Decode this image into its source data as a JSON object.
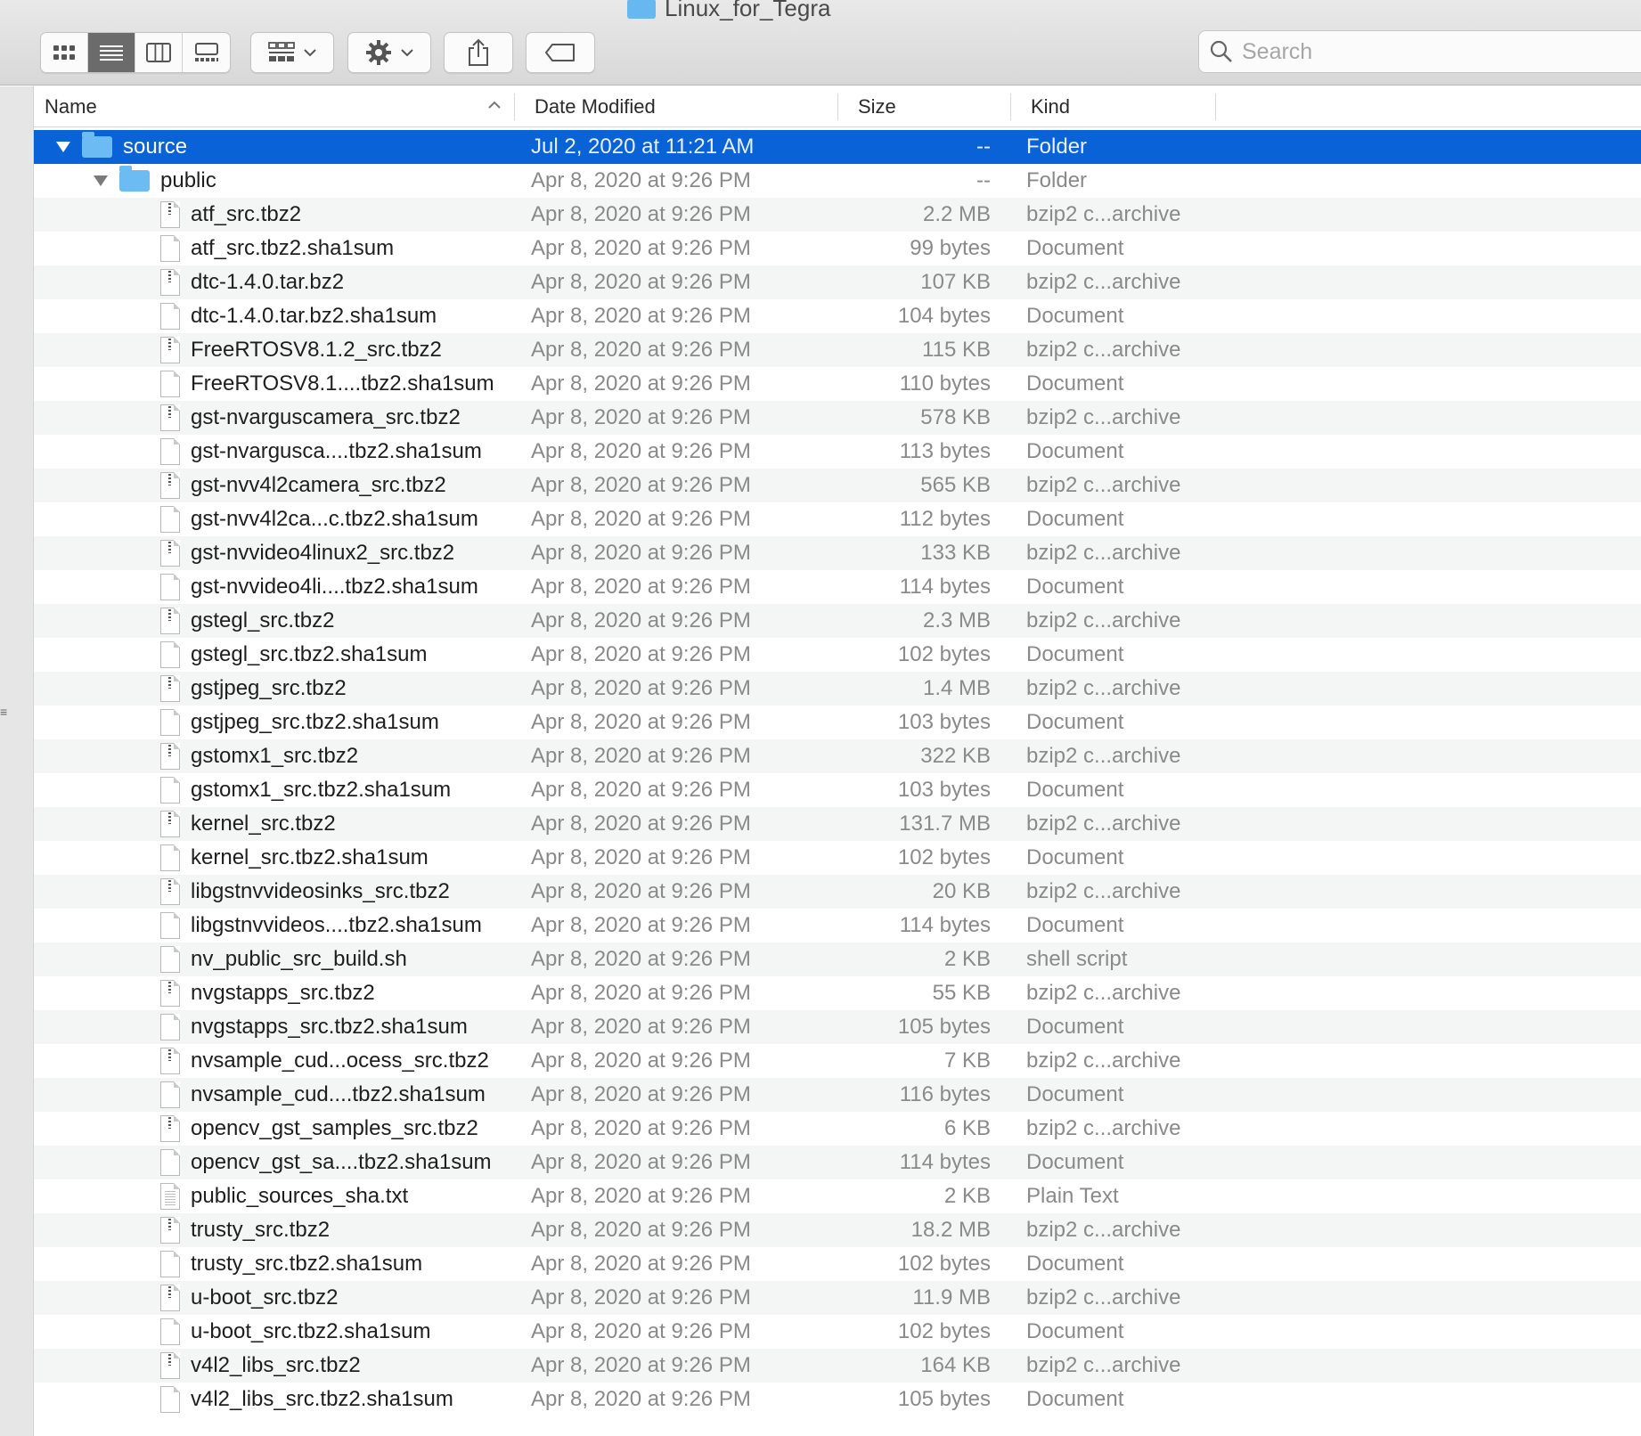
{
  "window": {
    "title": "Linux_for_Tegra"
  },
  "toolbar": {
    "view_modes": [
      "icon-view",
      "list-view",
      "column-view",
      "gallery-view"
    ],
    "active_view": "list-view",
    "group_icon": "group-by-icon",
    "action_icon": "gear-icon",
    "share_icon": "share-icon",
    "tag_icon": "tag-icon"
  },
  "search": {
    "placeholder": "Search"
  },
  "columns": {
    "name": "Name",
    "date": "Date Modified",
    "size": "Size",
    "kind": "Kind"
  },
  "colors": {
    "selection": "#0a63d6",
    "folder": "#6cbcf3"
  },
  "rows": [
    {
      "type": "folder",
      "level": 0,
      "expanded": true,
      "selected": true,
      "name": "source",
      "date": "Jul 2, 2020 at 11:21 AM",
      "size": "--",
      "kind": "Folder"
    },
    {
      "type": "folder",
      "level": 1,
      "expanded": true,
      "selected": false,
      "name": "public",
      "date": "Apr 8, 2020 at 9:26 PM",
      "size": "--",
      "kind": "Folder"
    },
    {
      "type": "zip",
      "level": 2,
      "name": "atf_src.tbz2",
      "date": "Apr 8, 2020 at 9:26 PM",
      "size": "2.2 MB",
      "kind": "bzip2 c...archive"
    },
    {
      "type": "doc",
      "level": 2,
      "name": "atf_src.tbz2.sha1sum",
      "date": "Apr 8, 2020 at 9:26 PM",
      "size": "99 bytes",
      "kind": "Document"
    },
    {
      "type": "zip",
      "level": 2,
      "name": "dtc-1.4.0.tar.bz2",
      "date": "Apr 8, 2020 at 9:26 PM",
      "size": "107 KB",
      "kind": "bzip2 c...archive"
    },
    {
      "type": "doc",
      "level": 2,
      "name": "dtc-1.4.0.tar.bz2.sha1sum",
      "date": "Apr 8, 2020 at 9:26 PM",
      "size": "104 bytes",
      "kind": "Document"
    },
    {
      "type": "zip",
      "level": 2,
      "name": "FreeRTOSV8.1.2_src.tbz2",
      "date": "Apr 8, 2020 at 9:26 PM",
      "size": "115 KB",
      "kind": "bzip2 c...archive"
    },
    {
      "type": "doc",
      "level": 2,
      "name": "FreeRTOSV8.1....tbz2.sha1sum",
      "date": "Apr 8, 2020 at 9:26 PM",
      "size": "110 bytes",
      "kind": "Document"
    },
    {
      "type": "zip",
      "level": 2,
      "name": "gst-nvarguscamera_src.tbz2",
      "date": "Apr 8, 2020 at 9:26 PM",
      "size": "578 KB",
      "kind": "bzip2 c...archive"
    },
    {
      "type": "doc",
      "level": 2,
      "name": "gst-nvarguscа....tbz2.sha1sum",
      "date": "Apr 8, 2020 at 9:26 PM",
      "size": "113 bytes",
      "kind": "Document"
    },
    {
      "type": "zip",
      "level": 2,
      "name": "gst-nvv4l2camera_src.tbz2",
      "date": "Apr 8, 2020 at 9:26 PM",
      "size": "565 KB",
      "kind": "bzip2 c...archive"
    },
    {
      "type": "doc",
      "level": 2,
      "name": "gst-nvv4l2ca...c.tbz2.sha1sum",
      "date": "Apr 8, 2020 at 9:26 PM",
      "size": "112 bytes",
      "kind": "Document"
    },
    {
      "type": "zip",
      "level": 2,
      "name": "gst-nvvideo4linux2_src.tbz2",
      "date": "Apr 8, 2020 at 9:26 PM",
      "size": "133 KB",
      "kind": "bzip2 c...archive"
    },
    {
      "type": "doc",
      "level": 2,
      "name": "gst-nvvideo4li....tbz2.sha1sum",
      "date": "Apr 8, 2020 at 9:26 PM",
      "size": "114 bytes",
      "kind": "Document"
    },
    {
      "type": "zip",
      "level": 2,
      "name": "gstegl_src.tbz2",
      "date": "Apr 8, 2020 at 9:26 PM",
      "size": "2.3 MB",
      "kind": "bzip2 c...archive"
    },
    {
      "type": "doc",
      "level": 2,
      "name": "gstegl_src.tbz2.sha1sum",
      "date": "Apr 8, 2020 at 9:26 PM",
      "size": "102 bytes",
      "kind": "Document"
    },
    {
      "type": "zip",
      "level": 2,
      "name": "gstjpeg_src.tbz2",
      "date": "Apr 8, 2020 at 9:26 PM",
      "size": "1.4 MB",
      "kind": "bzip2 c...archive"
    },
    {
      "type": "doc",
      "level": 2,
      "name": "gstjpeg_src.tbz2.sha1sum",
      "date": "Apr 8, 2020 at 9:26 PM",
      "size": "103 bytes",
      "kind": "Document"
    },
    {
      "type": "zip",
      "level": 2,
      "name": "gstomx1_src.tbz2",
      "date": "Apr 8, 2020 at 9:26 PM",
      "size": "322 KB",
      "kind": "bzip2 c...archive"
    },
    {
      "type": "doc",
      "level": 2,
      "name": "gstomx1_src.tbz2.sha1sum",
      "date": "Apr 8, 2020 at 9:26 PM",
      "size": "103 bytes",
      "kind": "Document"
    },
    {
      "type": "zip",
      "level": 2,
      "name": "kernel_src.tbz2",
      "date": "Apr 8, 2020 at 9:26 PM",
      "size": "131.7 MB",
      "kind": "bzip2 c...archive"
    },
    {
      "type": "doc",
      "level": 2,
      "name": "kernel_src.tbz2.sha1sum",
      "date": "Apr 8, 2020 at 9:26 PM",
      "size": "102 bytes",
      "kind": "Document"
    },
    {
      "type": "zip",
      "level": 2,
      "name": "libgstnvvideosinks_src.tbz2",
      "date": "Apr 8, 2020 at 9:26 PM",
      "size": "20 KB",
      "kind": "bzip2 c...archive"
    },
    {
      "type": "doc",
      "level": 2,
      "name": "libgstnvvideos....tbz2.sha1sum",
      "date": "Apr 8, 2020 at 9:26 PM",
      "size": "114 bytes",
      "kind": "Document"
    },
    {
      "type": "doc",
      "level": 2,
      "name": "nv_public_src_build.sh",
      "date": "Apr 8, 2020 at 9:26 PM",
      "size": "2 KB",
      "kind": "shell script"
    },
    {
      "type": "zip",
      "level": 2,
      "name": "nvgstapps_src.tbz2",
      "date": "Apr 8, 2020 at 9:26 PM",
      "size": "55 KB",
      "kind": "bzip2 c...archive"
    },
    {
      "type": "doc",
      "level": 2,
      "name": "nvgstapps_src.tbz2.sha1sum",
      "date": "Apr 8, 2020 at 9:26 PM",
      "size": "105 bytes",
      "kind": "Document"
    },
    {
      "type": "zip",
      "level": 2,
      "name": "nvsample_cud...ocess_src.tbz2",
      "date": "Apr 8, 2020 at 9:26 PM",
      "size": "7 KB",
      "kind": "bzip2 c...archive"
    },
    {
      "type": "doc",
      "level": 2,
      "name": "nvsample_cud....tbz2.sha1sum",
      "date": "Apr 8, 2020 at 9:26 PM",
      "size": "116 bytes",
      "kind": "Document"
    },
    {
      "type": "zip",
      "level": 2,
      "name": "opencv_gst_samples_src.tbz2",
      "date": "Apr 8, 2020 at 9:26 PM",
      "size": "6 KB",
      "kind": "bzip2 c...archive"
    },
    {
      "type": "doc",
      "level": 2,
      "name": "opencv_gst_sa....tbz2.sha1sum",
      "date": "Apr 8, 2020 at 9:26 PM",
      "size": "114 bytes",
      "kind": "Document"
    },
    {
      "type": "txt",
      "level": 2,
      "name": "public_sources_sha.txt",
      "date": "Apr 8, 2020 at 9:26 PM",
      "size": "2 KB",
      "kind": "Plain Text"
    },
    {
      "type": "zip",
      "level": 2,
      "name": "trusty_src.tbz2",
      "date": "Apr 8, 2020 at 9:26 PM",
      "size": "18.2 MB",
      "kind": "bzip2 c...archive"
    },
    {
      "type": "doc",
      "level": 2,
      "name": "trusty_src.tbz2.sha1sum",
      "date": "Apr 8, 2020 at 9:26 PM",
      "size": "102 bytes",
      "kind": "Document"
    },
    {
      "type": "zip",
      "level": 2,
      "name": "u-boot_src.tbz2",
      "date": "Apr 8, 2020 at 9:26 PM",
      "size": "11.9 MB",
      "kind": "bzip2 c...archive"
    },
    {
      "type": "doc",
      "level": 2,
      "name": "u-boot_src.tbz2.sha1sum",
      "date": "Apr 8, 2020 at 9:26 PM",
      "size": "102 bytes",
      "kind": "Document"
    },
    {
      "type": "zip",
      "level": 2,
      "name": "v4l2_libs_src.tbz2",
      "date": "Apr 8, 2020 at 9:26 PM",
      "size": "164 KB",
      "kind": "bzip2 c...archive"
    },
    {
      "type": "doc",
      "level": 2,
      "name": "v4l2_libs_src.tbz2.sha1sum",
      "date": "Apr 8, 2020 at 9:26 PM",
      "size": "105 bytes",
      "kind": "Document"
    }
  ]
}
